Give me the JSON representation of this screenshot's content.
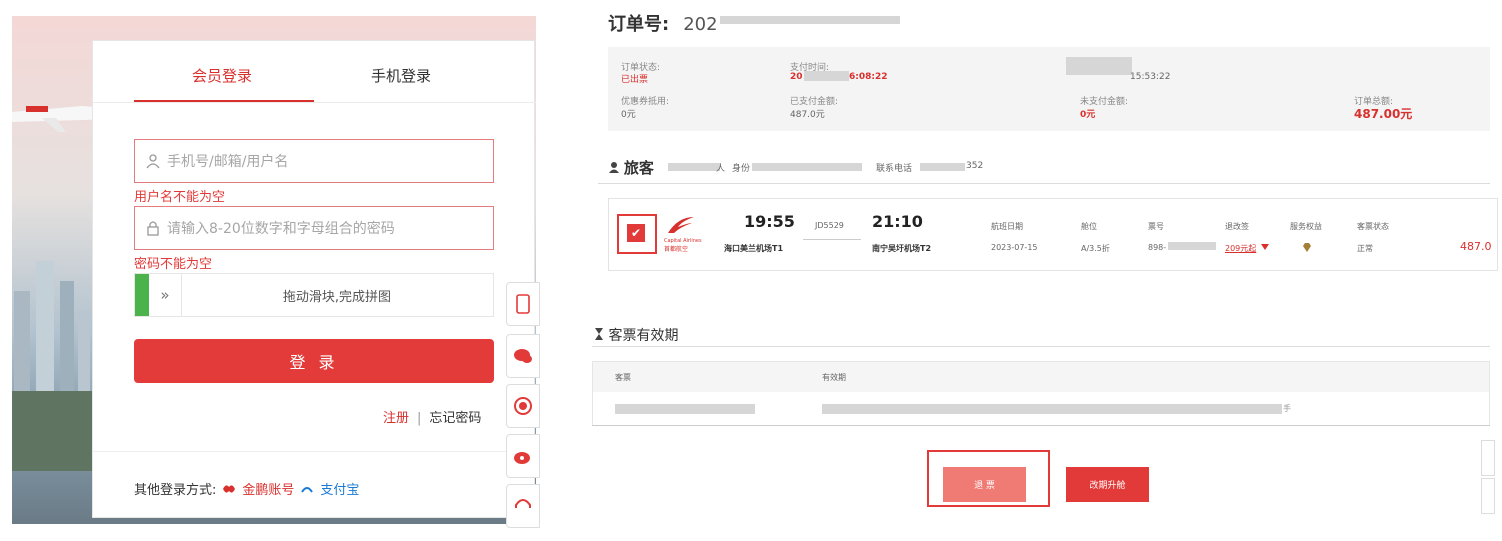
{
  "login": {
    "tabs": [
      "会员登录",
      "手机登录"
    ],
    "username_placeholder": "手机号/邮箱/用户名",
    "username_error": "用户名不能为空",
    "password_placeholder": "请输入8-20位数字和字母组合的密码",
    "password_error": "密码不能为空",
    "slider_arrow": "»",
    "slider_text": "拖动滑块,完成拼图",
    "login_button": "登 录",
    "register_link": "注册",
    "link_separator": "|",
    "forgot_link": "忘记密码",
    "other_label": "其他登录方式:",
    "golden_account": "金鹏账号",
    "alipay": "支付宝",
    "side_icons": [
      "phone-icon",
      "wechat-icon",
      "service-24h-icon",
      "weibo-icon",
      "headset-icon"
    ]
  },
  "order": {
    "order_no_label": "订单号:",
    "order_no_value": "202",
    "status_label": "订单状态:",
    "status_value": "已出票",
    "pay_time_label": "支付时间:",
    "pay_time_prefix": "20",
    "pay_time_suffix": "6:08:22",
    "create_time_value": "15:53:22",
    "coupon_label": "优惠券抵用:",
    "coupon_value": "0元",
    "paid_label": "已支付金额:",
    "paid_value": "487.0元",
    "unpaid_label": "未支付金额:",
    "unpaid_value": "0元",
    "total_label": "订单总额:",
    "total_value": "487.00元",
    "passenger_title": "旅客",
    "passenger_suffix": "人",
    "id_label": "身份",
    "phone_label": "联系电话",
    "phone_value": "352"
  },
  "flight": {
    "airline_name": "首都航空",
    "airline_en": "Capital Airlines",
    "dep_time": "19:55",
    "flight_no": "JD5529",
    "arr_time": "21:10",
    "dep_airport": "海口美兰机场T1",
    "arr_airport": "南宁吴圩机场T2",
    "col_date_label": "航班日期",
    "col_date_value": "2023-07-15",
    "col_cabin_label": "舱位",
    "col_cabin_value": "A/3.5折",
    "col_ticket_label": "票号",
    "col_ticket_value": "898-",
    "col_change_label": "退改签",
    "col_change_value": "209元起",
    "col_service_label": "服务权益",
    "col_status_label": "客票状态",
    "col_status_value": "正常",
    "price": "487.0"
  },
  "validity": {
    "title": "客票有效期",
    "col_ticket": "客票",
    "col_validity": "有效期",
    "tail_char": "手"
  },
  "actions": {
    "refund": "退 票",
    "change": "改期升舱"
  },
  "colors": {
    "accent": "#e23a38",
    "slider_green": "#4cb24c"
  }
}
